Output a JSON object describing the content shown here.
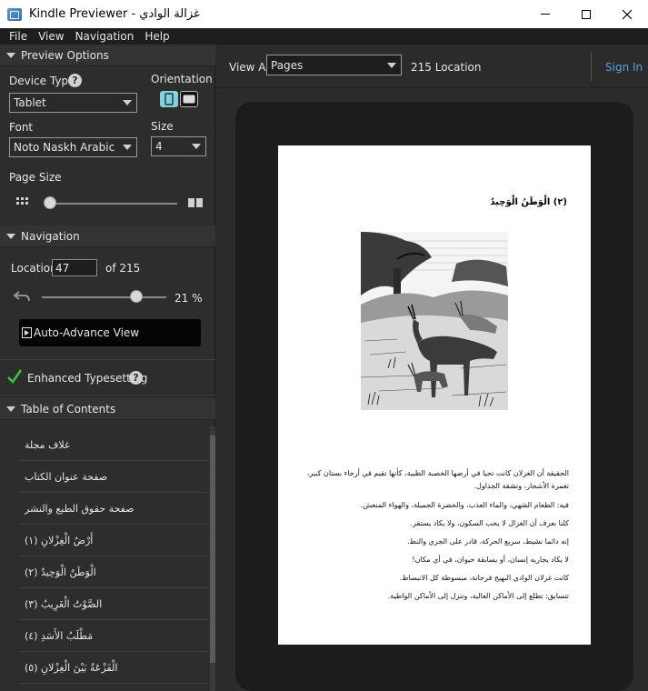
{
  "window": {
    "app_name": "Kindle Previewer - غزالة الوادي",
    "buttons": [
      "minimize",
      "maximize",
      "close"
    ]
  },
  "menu": [
    "File",
    "View",
    "Navigation",
    "Help"
  ],
  "preview_options": {
    "header": "Preview Options",
    "device_type_label": "Device Type",
    "device_type_value": "Tablet",
    "orientation_label": "Orientation",
    "font_label": "Font",
    "font_value": "Noto Naskh Arabic",
    "size_label": "Size",
    "size_value": "4",
    "page_size_label": "Page Size",
    "page_size_level": 0
  },
  "navigation": {
    "header": "Navigation",
    "location_label": "Location",
    "location_value": "47",
    "of_label": "of 215",
    "progress_percent_label": "21 %",
    "progress_fraction": 0.21,
    "auto_advance_label": "Auto-Advance View"
  },
  "typesetting": {
    "label": "Enhanced Typesetting"
  },
  "toc": {
    "header": "Table of Contents",
    "items": [
      "غلاف مجلة",
      "صفحة عنوان الكتاب",
      "صفحة حقوق الطبع والنشر",
      "أَرْضُ الْغِزْلانِ (١)",
      "الْوَطَنُ الْوَحِيدُ (٢)",
      "الصَّوْتُ الْغَرِيبُ (٣)",
      "مَطْلَبُ الأَسَدِ (٤)",
      "الْفَزْعَةُ بَيْنَ الْغِزْلانِ (٥)"
    ]
  },
  "toolbar": {
    "view_all_label": "View All",
    "view_select_value": "Pages",
    "location_count": "215 Location",
    "sign_in_label": "Sign In"
  },
  "page": {
    "chapter_title": "(٢) الْوَطَنُ الْوَحِيدُ",
    "paragraphs": [
      "الحقيقة أن الغزلان كانت تحيا في أرضها الخصبة الظبية، كأنها تقيم في أرجاء بستان كبير،",
      "تغمرة الأشجار، وتشقة الجداول.",
      "فيه: الطعام الشهي، والماء العذب، والخضرة الجميلة، والهواء المنعش.",
      "كلنا نعرف أن الغزال لا يحب السكون، ولا يكاد يستقر.",
      "إنه دائما نشيط، سريع الحركة، قادر على الجري والنط.",
      "لا يكاد يجاريه إنسان، أو يسابقة حيوان، في أي مكان!",
      "كانت غزلان الوادي البهيج فرحانة، مبسوطة كل الانبساط.",
      "تتسابق: تطلع إلى الأماكن العالية، وتنزل إلى الأماكن الواطية."
    ]
  },
  "colors": {
    "panel_bg": "#2d2d2d",
    "accent_link": "#4fa3e0",
    "check_green": "#3cc23c",
    "orientation_active": "#7fd3e0"
  }
}
